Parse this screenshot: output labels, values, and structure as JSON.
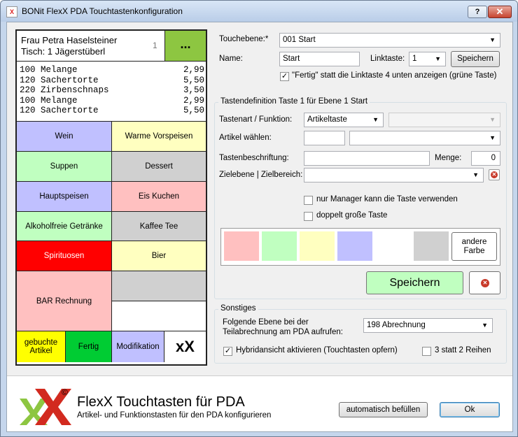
{
  "window": {
    "title": "BONit FlexX PDA Touchtastenkonfiguration",
    "help_label": "?",
    "close_label": "✕"
  },
  "pda": {
    "customer": "Frau Petra Haselsteiner",
    "table": "Tisch: 1 Jägerstüberl",
    "count": "1",
    "dots": "...",
    "items": [
      {
        "text": "100 Melange",
        "price": "2,99"
      },
      {
        "text": "120 Sachertorte",
        "price": "5,50"
      },
      {
        "text": "220 Zirbenschnaps",
        "price": "3,50"
      },
      {
        "text": "100 Melange",
        "price": "2,99"
      },
      {
        "text": "120 Sachertorte",
        "price": "5,50"
      }
    ],
    "keys": {
      "wein": "Wein",
      "warme_vorspeisen": "Warme Vorspeisen",
      "suppen": "Suppen",
      "dessert": "Dessert",
      "hauptspeisen": "Hauptspeisen",
      "eis_kuchen": "Eis Kuchen",
      "alkoholfreie": "Alkoholfreie Getränke",
      "kaffee_tee": "Kaffee Tee",
      "spirituosen": "Spirituosen",
      "bier": "Bier",
      "bar_rechnung": "BAR Rechnung",
      "gebuchte_artikel": "gebuchte Artikel",
      "fertig": "Fertig",
      "modifikation": "Modifikation",
      "logo": "xX"
    }
  },
  "form": {
    "touchebene_label": "Touchebene:*",
    "touchebene_value": "001 Start",
    "name_label": "Name:",
    "name_value": "Start",
    "linktaste_label": "Linktaste:",
    "linktaste_value": "1",
    "save_label": "Speichern",
    "fertig_checkbox_label": "\"Fertig\" statt die Linktaste 4 unten anzeigen (grüne Taste)",
    "fertig_checked": "✓"
  },
  "tastendef": {
    "title": "Tastendefinition Taste 1 für Ebene 1 Start",
    "tastenart_label": "Tastenart / Funktion:",
    "tastenart_value": "Artikeltaste",
    "artikel_label": "Artikel wählen:",
    "beschriftung_label": "Tastenbeschriftung:",
    "menge_label": "Menge:",
    "menge_value": "0",
    "zielebene_label": "Zielebene | Zielbereich:",
    "manager_label": "nur Manager kann die Taste verwenden",
    "doppelt_label": "doppelt große Taste",
    "andere_farbe_label": "andere Farbe",
    "save_label": "Speichern",
    "colors": [
      "#ffc0c0",
      "#c0ffc0",
      "#ffffc0",
      "#c0c0ff",
      "#ffffff",
      "#d0d0d0"
    ]
  },
  "sonstiges": {
    "title": "Sonstiges",
    "ebene_label": "Folgende Ebene bei der Teilabrechnung am PDA aufrufen:",
    "ebene_value": "198 Abrechnung",
    "hybrid_label": "Hybridansicht aktivieren (Touchtasten opfern)",
    "hybrid_checked": "✓",
    "reihen_label": "3 statt 2 Reihen"
  },
  "footer": {
    "title": "FlexX Touchtasten für PDA",
    "subtitle": "Artikel- und Funktionstasten für den PDA konfigurieren",
    "auto_label": "automatisch befüllen",
    "ok_label": "Ok",
    "logo_mark": "©"
  }
}
